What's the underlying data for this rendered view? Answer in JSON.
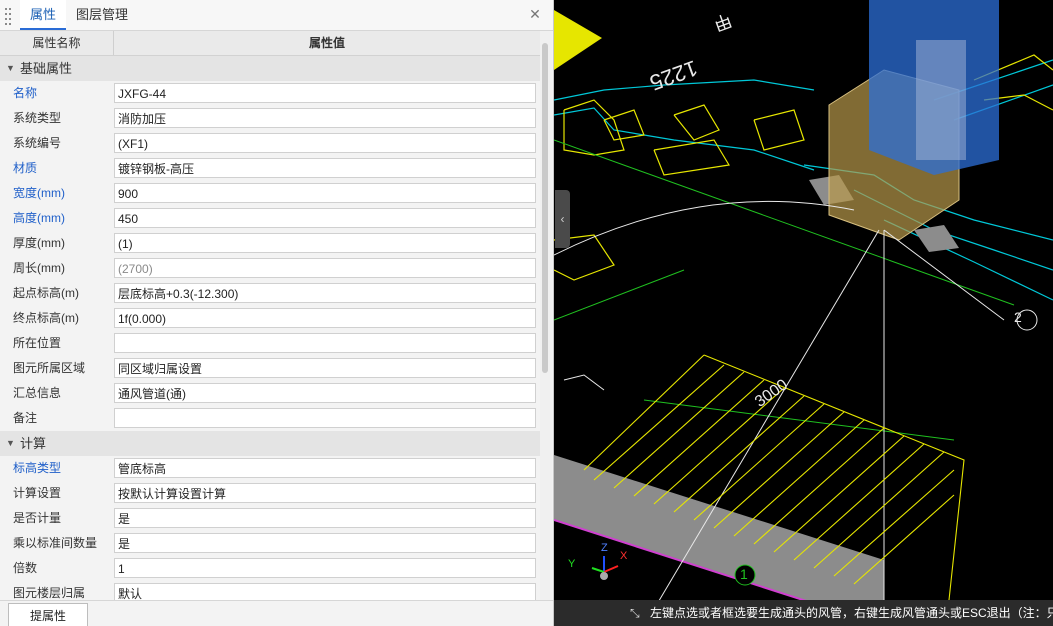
{
  "panel": {
    "tabs": [
      {
        "label": "属性",
        "active": true
      },
      {
        "label": "图层管理",
        "active": false
      }
    ],
    "close_icon": "close-icon",
    "columns": {
      "name": "属性名称",
      "value": "属性值"
    },
    "groups": [
      {
        "title": "基础属性",
        "rows": [
          {
            "label": "名称",
            "value": "JXFG-44",
            "blue": true
          },
          {
            "label": "系统类型",
            "value": "消防加压",
            "blue": false
          },
          {
            "label": "系统编号",
            "value": "(XF1)",
            "blue": false
          },
          {
            "label": "材质",
            "value": "镀锌钢板-高压",
            "blue": true
          },
          {
            "label": "宽度(mm)",
            "value": "900",
            "blue": true
          },
          {
            "label": "高度(mm)",
            "value": "450",
            "blue": true
          },
          {
            "label": "厚度(mm)",
            "value": "(1)",
            "blue": false
          },
          {
            "label": "周长(mm)",
            "value": "(2700)",
            "blue": false,
            "grey": true
          },
          {
            "label": "起点标高(m)",
            "value": "层底标高+0.3(-12.300)",
            "blue": false
          },
          {
            "label": "终点标高(m)",
            "value": "1f(0.000)",
            "blue": false
          },
          {
            "label": "所在位置",
            "value": "",
            "blue": false
          },
          {
            "label": "图元所属区域",
            "value": "同区域归属设置",
            "blue": false
          },
          {
            "label": "汇总信息",
            "value": "通风管道(通)",
            "blue": false
          },
          {
            "label": "备注",
            "value": "",
            "blue": false
          }
        ]
      },
      {
        "title": "计算",
        "rows": [
          {
            "label": "标高类型",
            "value": "管底标高",
            "blue": true
          },
          {
            "label": "计算设置",
            "value": "按默认计算设置计算",
            "blue": false
          },
          {
            "label": "是否计量",
            "value": "是",
            "blue": false
          },
          {
            "label": "乘以标准间数量",
            "value": "是",
            "blue": false
          },
          {
            "label": "倍数",
            "value": "1",
            "blue": false
          },
          {
            "label": "图元楼层归属",
            "value": "默认",
            "blue": false
          }
        ]
      }
    ],
    "footer_button": "提属性"
  },
  "viewport": {
    "collapse_icon": "chevron-left-icon",
    "cad_texts": {
      "label_1225": "1225",
      "label_tag": "甲",
      "label_3000": "3000",
      "axis_2": "2",
      "axis_1": "1",
      "triad_x": "X",
      "triad_y": "Y",
      "triad_z": "Z"
    },
    "colors": {
      "yellow": "#e6e600",
      "cyan": "#00c8d8",
      "green": "#20c020",
      "white": "#e8e8e8",
      "blue_box": "#2c6fd8",
      "tan_box": "#b8994a",
      "grey_beam": "#8c8c8c",
      "magenta": "#d040d0"
    },
    "status_icon": "cursor-select-icon",
    "status_text": "左键点选或者框选要生成通头的风管，右键生成风管通头或ESC退出（注：只"
  }
}
